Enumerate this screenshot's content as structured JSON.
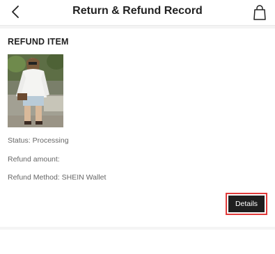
{
  "header": {
    "title": "Return & Refund Record",
    "back_icon": "chevron-left-icon",
    "bag_icon": "shopping-bag-icon"
  },
  "refund": {
    "section_title": "REFUND ITEM",
    "status": "Status: Processing",
    "amount": "Refund amount:",
    "method": "Refund Method: SHEIN Wallet",
    "details_label": "Details"
  },
  "colors": {
    "highlight": "#e03a3a",
    "button_bg": "#1f1f1f"
  }
}
